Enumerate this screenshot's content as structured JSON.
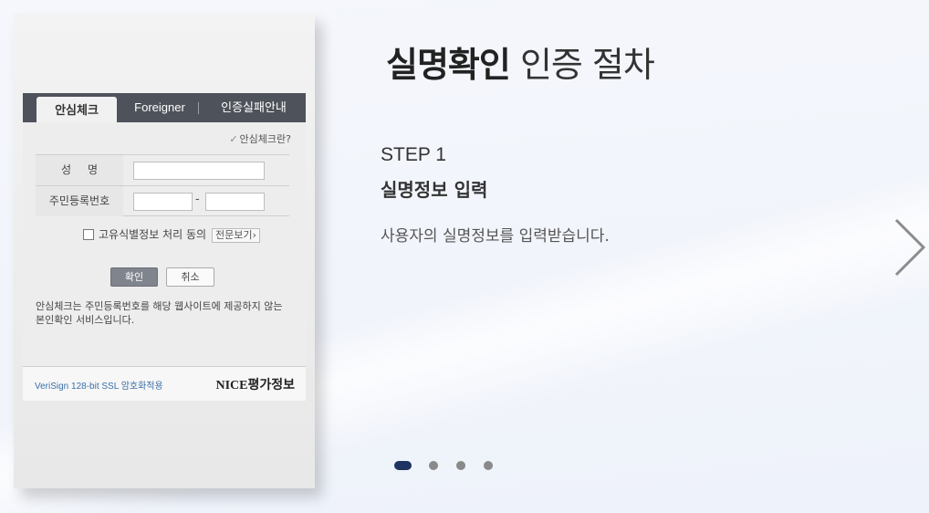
{
  "form": {
    "tabs": [
      "안심체크",
      "Foreigner",
      "인증실패안내"
    ],
    "whatis": "안심체크란?",
    "name_label": "성명",
    "rrn_label": "주민등록번호",
    "agree_label": "고유식별정보 처리 동의",
    "fulltext_label": "전문보기",
    "ok_label": "확인",
    "cancel_label": "취소",
    "description": "안심체크는 주민등록번호를 해당 웹사이트에 제공하지 않는 본인확인 서비스입니다.",
    "ssl_text": "VeriSign 128-bit SSL 암호화적용",
    "brand": "NICE평가정보"
  },
  "content": {
    "title_bold": "실명확인",
    "title_light": "인증 절차",
    "step": "STEP 1",
    "step_title": "실명정보 입력",
    "step_desc": "사용자의 실명정보를 입력받습니다."
  },
  "carousel": {
    "total_slides": 4,
    "active_slide": 1
  },
  "colors": {
    "tab_bar": "#4e525a",
    "active_dot": "#1d3462",
    "ok_button": "#80848d"
  }
}
